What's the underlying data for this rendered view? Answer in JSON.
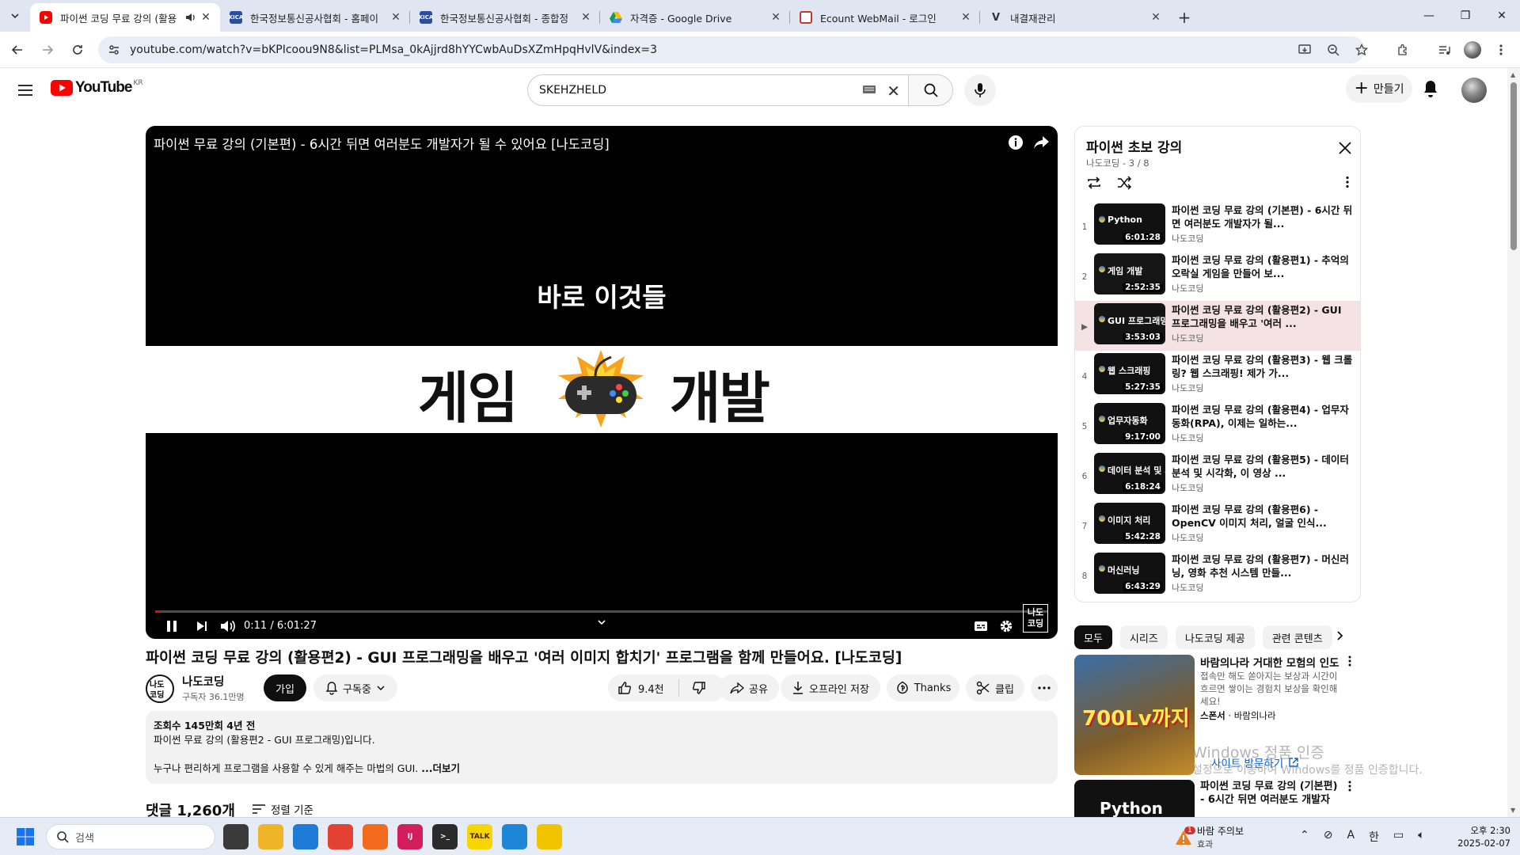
{
  "browser": {
    "tabs": [
      {
        "title": "파이썬 코딩 무료 강의 (활용",
        "favicon": "youtube",
        "active": true
      },
      {
        "title": "한국정보통신공사협회 - 홈페이",
        "favicon": "kica"
      },
      {
        "title": "한국정보통신공사협회 - 종합정",
        "favicon": "kica"
      },
      {
        "title": "자격증 - Google Drive",
        "favicon": "drive"
      },
      {
        "title": "Ecount WebMail - 로그인",
        "favicon": "ecount"
      },
      {
        "title": "내결재관리",
        "favicon": "v"
      }
    ],
    "kica_badge": "KICA",
    "address": "youtube.com/watch?v=bKPIcoou9N8&list=PLMsa_0kAjjrd8hYYCwbAuDsXZmHpqHvlV&index=3"
  },
  "youtube": {
    "logo_text": "YouTube",
    "region": "KR",
    "search_value": "SKEHZHELD",
    "create_label": "만들기"
  },
  "player": {
    "title": "파이썬 무료 강의 (기본편) - 6시간 뒤면 여러분도 개발자가 될 수 있어요 [나도코딩]",
    "subtitle": "바로 이것들",
    "overlay_left": "게임",
    "overlay_right": "개발",
    "time_current": "0:11",
    "time_total": "6:01:27",
    "progress_fraction": 0.0005,
    "watermark": "나도\n코딩"
  },
  "video": {
    "title": "파이썬 코딩 무료 강의 (활용편2) - GUI 프로그래밍을 배우고 '여러 이미지 합치기' 프로그램을 함께 만들어요. [나도코딩]",
    "channel": "나도코딩",
    "subscribers": "구독자 36.1만명",
    "avatar_text": "나도코딩",
    "join_label": "가입",
    "subscribed_label": "구독중",
    "likes": "9.4천",
    "share_label": "공유",
    "download_label": "오프라인 저장",
    "thanks_label": "Thanks",
    "clip_label": "클립",
    "description": {
      "meta": "조회수 145만회  4년 전",
      "line1": "파이썬 무료 강의 (활용편2 - GUI 프로그래밍)입니다.",
      "line2": "누구나 편리하게 프로그램을 사용할 수 있게 해주는 마법의 GUI.",
      "more": "...더보기"
    },
    "comments_label": "댓글 1,260개",
    "sort_label": "정렬 기준"
  },
  "playlist": {
    "title": "파이썬 초보 강의",
    "sub": "나도코딩 - 3 / 8",
    "items": [
      {
        "index": "1",
        "title": "파이썬 코딩 무료 강의 (기본편) - 6시간 뒤면 여러분도 개발자가 될...",
        "channel": "나도코딩",
        "thumb": "Python",
        "duration": "6:01:28",
        "bg": "#111111"
      },
      {
        "index": "2",
        "title": "파이썬 코딩 무료 강의 (활용편1) - 추억의 오락실 게임을 만들어 보...",
        "channel": "나도코딩",
        "thumb": "게임 개발",
        "duration": "2:52:35",
        "bg": "#151515"
      },
      {
        "index": "▶",
        "title": "파이썬 코딩 무료 강의 (활용편2) - GUI 프로그래밍을 배우고 '여러 ...",
        "channel": "나도코딩",
        "thumb": "GUI 프로그래밍",
        "duration": "3:53:03",
        "bg": "#141414"
      },
      {
        "index": "4",
        "title": "파이썬 코딩 무료 강의 (활용편3) - 웹 크롤링? 웹 스크래핑! 제가 가...",
        "channel": "나도코딩",
        "thumb": "웹 스크래핑",
        "duration": "5:27:35",
        "bg": "#111111"
      },
      {
        "index": "5",
        "title": "파이썬 코딩 무료 강의 (활용편4) - 업무자동화(RPA), 이제는 일하는...",
        "channel": "나도코딩",
        "thumb": "업무자동화",
        "duration": "9:17:00",
        "bg": "#111111"
      },
      {
        "index": "6",
        "title": "파이썬 코딩 무료 강의 (활용편5) - 데이터 분석 및 시각화, 이 영상 ...",
        "channel": "나도코딩",
        "thumb": "데이터 분석 및 시각화",
        "duration": "6:18:24",
        "bg": "#111111"
      },
      {
        "index": "7",
        "title": "파이썬 코딩 무료 강의 (활용편6) - OpenCV 이미지 처리, 얼굴 인식...",
        "channel": "나도코딩",
        "thumb": "이미지 처리",
        "duration": "5:42:28",
        "bg": "#111111"
      },
      {
        "index": "8",
        "title": "파이썬 코딩 무료 강의 (활용편7) - 머신러닝, 영화 추천 시스템 만들...",
        "channel": "나도코딩",
        "thumb": "머신러닝",
        "duration": "6:43:29",
        "bg": "#111111"
      }
    ]
  },
  "chips": [
    "모두",
    "시리즈",
    "나도코딩 제공",
    "관련 콘텐츠"
  ],
  "ad": {
    "title": "바람의나라 거대한 모험의 인도",
    "desc": "접속만 해도 쏟아지는 보상과 시간이 흐르면 쌓이는 경험치 보상을 확인해 세요!",
    "sponsor_label": "스폰서",
    "sponsor_name": "바람의나라",
    "thumb_text": "700Lv까지",
    "link_label": "사이트 방문하기"
  },
  "rec2": {
    "title": "파이썬 코딩 무료 강의 (기본편) - 6시간 뒤면 여러분도 개발자가...",
    "thumb": "Python"
  },
  "windows_watermark": {
    "line1": "Windows 정품 인증",
    "line2": "설정으로 이동하여 Windows를 정품 인증합니다."
  },
  "taskbar": {
    "search_placeholder": "검색",
    "weather_title": "바람 주의보",
    "weather_sub": "효과",
    "weather_badge": "1",
    "time": "오후 2:30",
    "date": "2025-02-07",
    "tray_ime": "A",
    "tray_lang": "한",
    "apps": [
      {
        "name": "task-view",
        "label": "",
        "color": "#3a3a3a"
      },
      {
        "name": "file-explorer",
        "label": "",
        "color": "#f0b429"
      },
      {
        "name": "edge",
        "label": "",
        "color": "#1f7bd8"
      },
      {
        "name": "chrome",
        "label": "",
        "color": "#e34133"
      },
      {
        "name": "app-orange",
        "label": "",
        "color": "#f26b1d"
      },
      {
        "name": "intellij",
        "label": "IJ",
        "color": "#d21e5b"
      },
      {
        "name": "terminal",
        "label": ">_",
        "color": "#2b2b2b"
      },
      {
        "name": "kakaotalk",
        "label": "TALK",
        "color": "#f7d600"
      },
      {
        "name": "vscode",
        "label": "",
        "color": "#1e86d6"
      },
      {
        "name": "sticky",
        "label": "",
        "color": "#f2c400"
      }
    ]
  }
}
